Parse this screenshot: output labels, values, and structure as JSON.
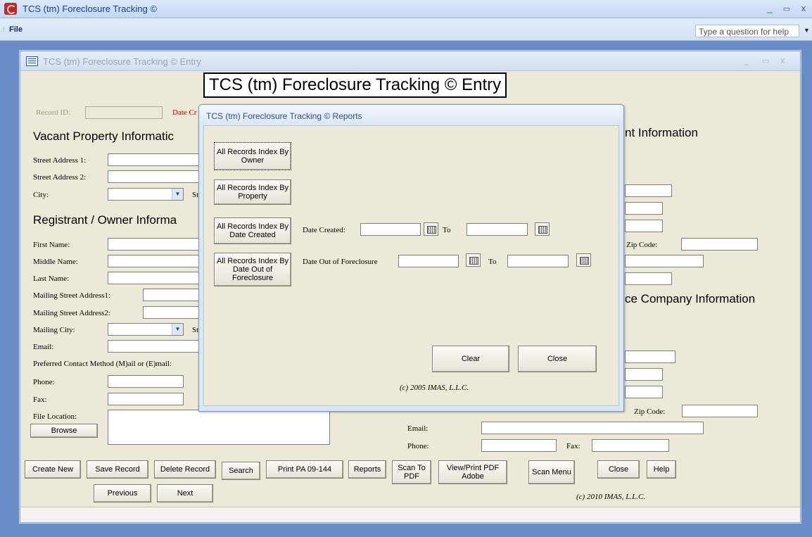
{
  "app": {
    "title": "TCS (tm) Foreclosure Tracking ©",
    "window_controls": {
      "minimize": "_",
      "restore": "▭",
      "close": "x"
    }
  },
  "menu": {
    "file": "File",
    "help_placeholder": "Type a question for help"
  },
  "entry_window": {
    "title": "TCS (tm) Foreclosure Tracking ©  Entry",
    "heading": "TCS (tm) Foreclosure Tracking ©  Entry",
    "record_id_label": "Record ID:",
    "date_created_label_partial": "Date Cr",
    "sections": {
      "vacant_property": "Vacant Property Informatic",
      "registrant_owner": "Registrant / Owner Informa",
      "right_top": "nt Information",
      "right_insurance": "ce Company Information"
    },
    "labels": {
      "street_address_1": "Street Address 1:",
      "street_address_2": "Street Address 2:",
      "city": "City:",
      "state_partial": "St",
      "first_name": "First Name:",
      "middle_name": "Middle Name:",
      "last_name": "Last Name:",
      "mailing_street_address1": "Mailing Street Address1:",
      "mailing_street_address2": "Mailing Street Address2:",
      "mailing_city": "Mailing City:",
      "mailing_state_partial": "St",
      "email": "Email:",
      "preferred_contact": "Preferred Contact Method (M)ail or (E)mail:",
      "phone": "Phone:",
      "fax": "Fax:",
      "file_location": "File Location:",
      "zip_code": "Zip Code:",
      "zip_code_2": "Zip Code:",
      "right_email": "Email:",
      "right_phone": "Phone:",
      "right_fax": "Fax:"
    },
    "browse_button": "Browse",
    "toolbar": {
      "create_new": "Create New",
      "save_record": "Save Record",
      "delete_record": "Delete Record",
      "search": "Search",
      "print_pa": "Print PA 09-144",
      "reports": "Reports",
      "scan_to_pdf": "Scan To PDF",
      "view_print_pdf": "View/Print PDF Adobe",
      "scan_menu": "Scan Menu",
      "close": "Close",
      "help": "Help",
      "previous": "Previous",
      "next": "Next"
    },
    "copyright": "(c) 2010 IMAS, L.L.C."
  },
  "reports_dialog": {
    "title": "TCS (tm) Foreclosure Tracking ©  Reports",
    "buttons": {
      "by_owner": "All Records Index By Owner",
      "by_property": "All Records Index By Property",
      "by_date_created": "All Records Index By Date Created",
      "by_date_out": "All Records Index By Date Out of Foreclosure",
      "clear": "Clear",
      "close": "Close"
    },
    "date_created_label": "Date Created:",
    "date_out_label": "Date Out of Foreclosure",
    "to_label_1": "To",
    "to_label_2": "To",
    "date_created_from": "",
    "date_created_to": "",
    "date_out_from": "",
    "date_out_to": "",
    "copyright": "(c) 2005 IMAS, L.L.C."
  },
  "colors": {
    "workspace": "#6a8dc8",
    "form_background": "#ece9d8",
    "accent_red": "#c00000"
  },
  "icons": [
    "app-logo-icon",
    "form-icon",
    "calendar-icon",
    "chevron-down-icon",
    "minimize-icon",
    "restore-icon",
    "close-icon"
  ]
}
